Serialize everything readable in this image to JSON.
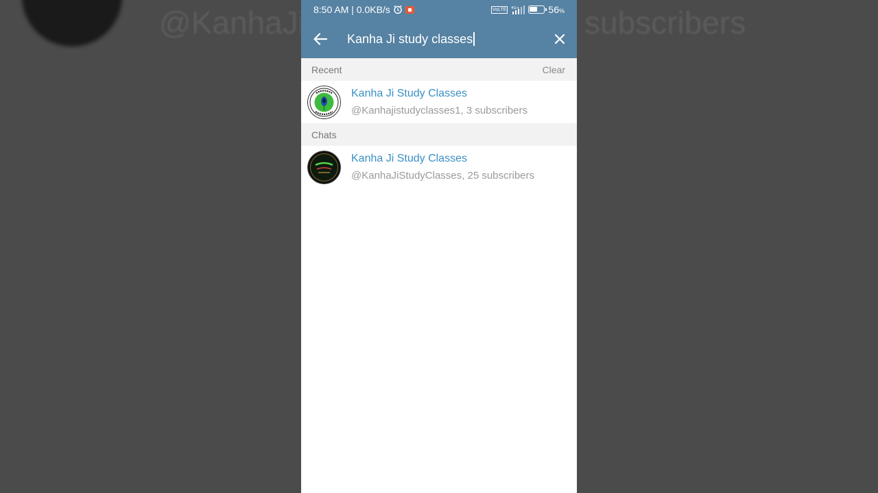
{
  "background": {
    "left_text": "@KanhaJi",
    "right_text": "subscribers"
  },
  "status_bar": {
    "time_net": "8:50 AM | 0.0KB/s",
    "network": "4G+",
    "battery": "56",
    "battery_unit": "%"
  },
  "search": {
    "query": "Kanha Ji study classes"
  },
  "recent": {
    "label": "Recent",
    "clear_label": "Clear",
    "items": [
      {
        "title": "Kanha Ji Study Classes",
        "subtitle": "@Kanhajistudyclasses1, 3 subscribers",
        "avatar": "peacock-feather-logo"
      }
    ]
  },
  "chats": {
    "label": "Chats",
    "items": [
      {
        "title": "Kanha Ji Study Classes",
        "subtitle": "@KanhaJiStudyClasses, 25 subscribers",
        "avatar": "kanha-ji-dark-logo"
      }
    ]
  },
  "colors": {
    "app_bar": "#5682a3",
    "link_title": "#3a8fc5",
    "section_bg": "#f2f2f2"
  }
}
